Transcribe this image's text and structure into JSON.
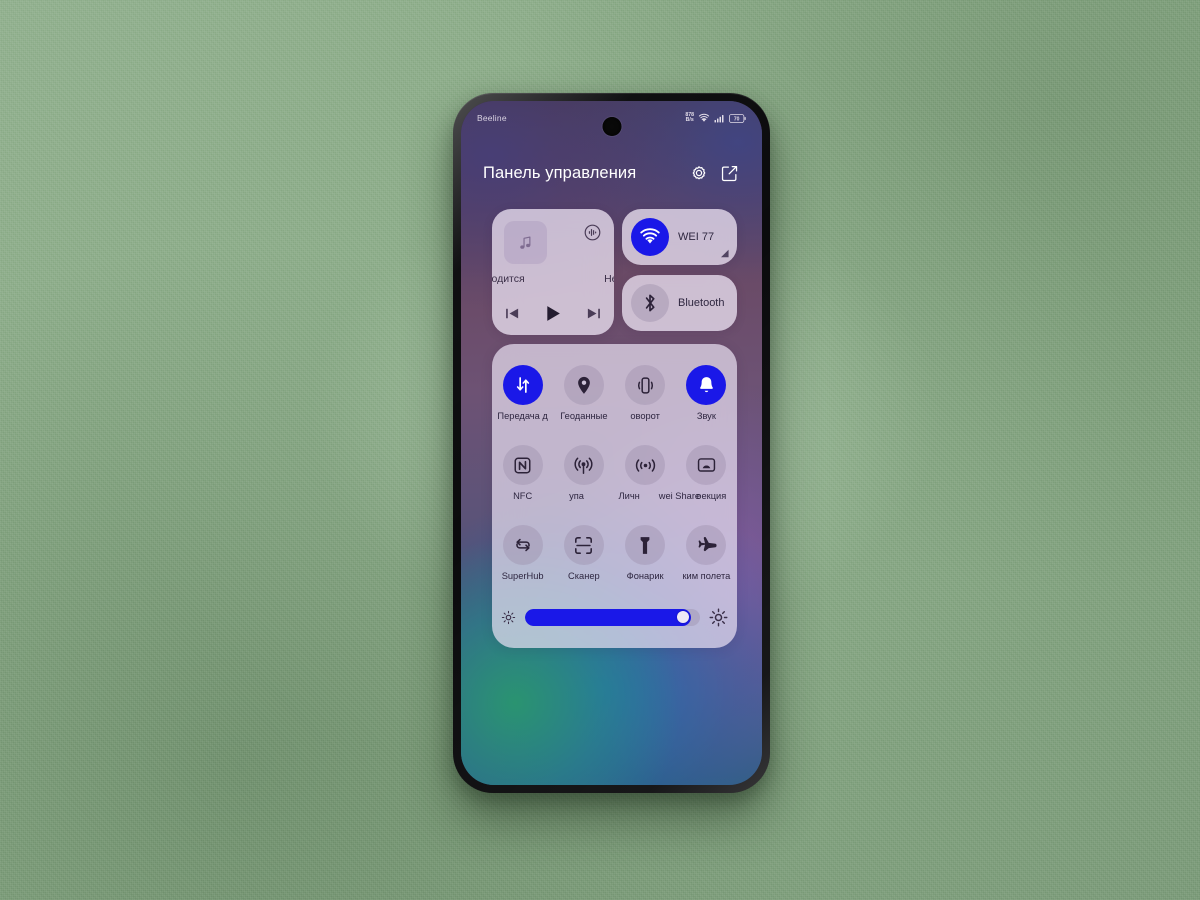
{
  "wallpaper_colors": {
    "purple": "#6a4a66",
    "blue": "#2f5f7e",
    "teal": "#2a966e"
  },
  "accent_blue": "#1a18e8",
  "statusbar": {
    "carrier": "Beeline",
    "net_speed_value": "878",
    "net_speed_unit": "B/s",
    "wifi_icon": "wifi-status-icon",
    "signal_icon": "cellular-signal-icon",
    "battery_icon": "battery-icon",
    "battery_level": "70"
  },
  "header": {
    "title": "Панель управления",
    "settings_icon": "gear-icon",
    "edit_icon": "edit-square-icon"
  },
  "media": {
    "album_art_icon": "music-note-icon",
    "cast_icon": "audio-output-icon",
    "title_text": "водится",
    "subtitle_text": "Не в",
    "prev_icon": "skip-previous-icon",
    "play_icon": "play-icon",
    "next_icon": "skip-next-icon"
  },
  "connectivity": [
    {
      "name": "wifi",
      "label": "WEI 77",
      "icon": "wifi-icon",
      "active": true,
      "has_expand_arrow": true
    },
    {
      "name": "bluetooth",
      "label": "Bluetooth",
      "icon": "bluetooth-icon",
      "active": false,
      "has_expand_arrow": false
    }
  ],
  "toggles": {
    "rows": [
      [
        {
          "label": "Передача д",
          "icon": "mobile-data-icon",
          "active": true
        },
        {
          "label": "Геоданные",
          "icon": "location-pin-icon",
          "active": false
        },
        {
          "label": "оворот",
          "icon": "auto-rotate-icon",
          "active": false
        },
        {
          "label": "Звук",
          "icon": "bell-sound-icon",
          "active": true
        }
      ],
      [
        {
          "label": "NFC",
          "icon": "nfc-icon",
          "active": false
        },
        {
          "label": "упа",
          "icon": "hotspot-icon",
          "active": false
        },
        {
          "label": "Личн",
          "icon": "huawei-share-icon",
          "active": false
        },
        {
          "label": "оекция",
          "icon": "screen-projection-icon",
          "active": false
        }
      ],
      [
        {
          "label": "SuperHub",
          "icon": "superhub-icon",
          "active": false
        },
        {
          "label": "Сканер",
          "icon": "scanner-icon",
          "active": false
        },
        {
          "label": "Фонарик",
          "icon": "flashlight-icon",
          "active": false
        },
        {
          "label": "ким полета",
          "icon": "airplane-icon",
          "active": false
        }
      ]
    ],
    "overlap_label": "wei Share"
  },
  "brightness": {
    "low_icon": "brightness-low-icon",
    "high_icon": "brightness-high-icon",
    "value_percent": 95
  }
}
